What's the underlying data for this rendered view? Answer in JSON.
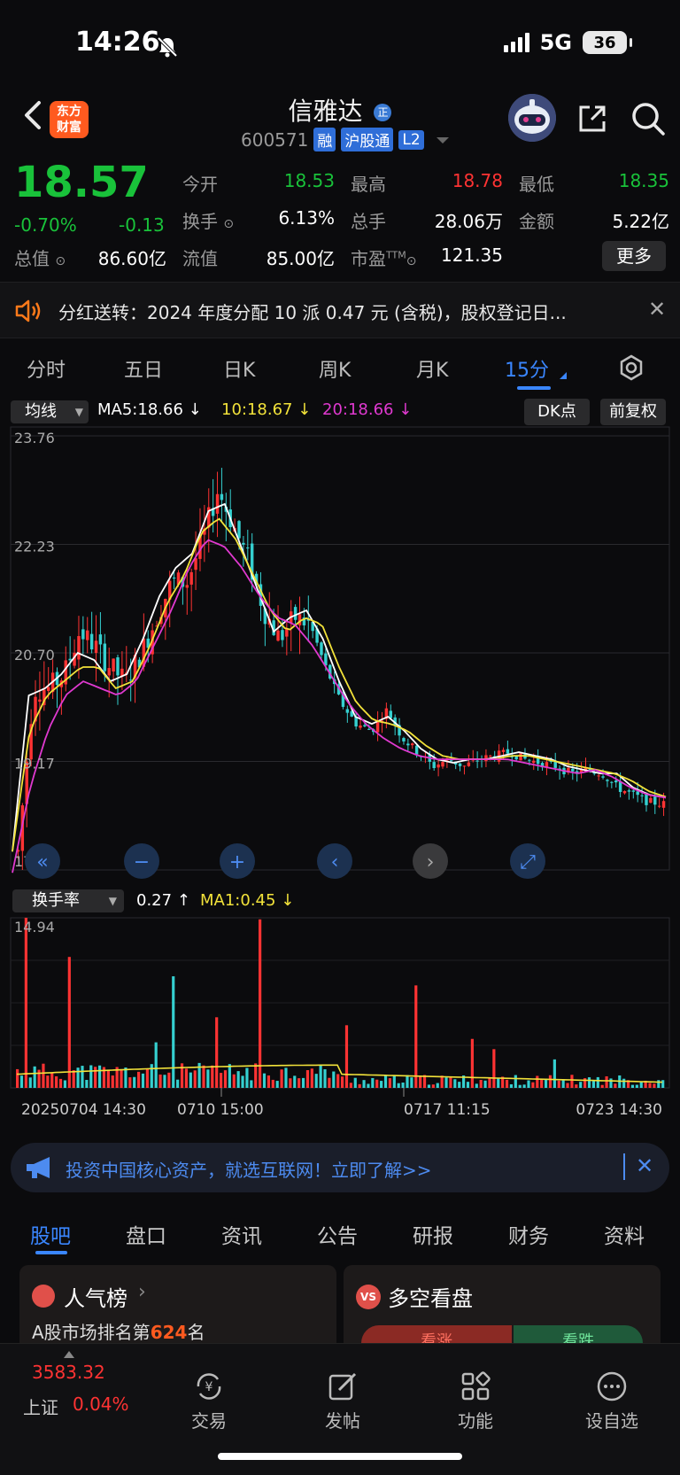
{
  "status_bar": {
    "time": "14:26",
    "network": "5G",
    "battery": "36"
  },
  "header": {
    "logo_line1": "东方",
    "logo_line2": "财富",
    "stock_name": "信雅达",
    "name_badge": "正",
    "stock_code": "600571",
    "tags": [
      "融",
      "沪股通",
      "L2"
    ]
  },
  "quote": {
    "price": "18.57",
    "change_pct": "-0.70%",
    "change": "-0.13",
    "open_label": "今开",
    "open": "18.53",
    "high_label": "最高",
    "high": "18.78",
    "low_label": "最低",
    "low": "18.35",
    "turnover_label": "换手",
    "turnover": "6.13%",
    "volume_label": "总手",
    "volume": "28.06万",
    "amount_label": "金额",
    "amount": "5.22亿",
    "total_cap_label": "总值",
    "total_cap": "86.60亿",
    "float_cap_label": "流值",
    "float_cap": "85.00亿",
    "pe_label": "市盈",
    "pe_sup": "TTM",
    "pe": "121.35",
    "more": "更多"
  },
  "notice": {
    "text": "分红送转：2024 年度分配 10 派 0.47 元 (含税)，股权登记日..."
  },
  "period_tabs": [
    "分时",
    "五日",
    "日K",
    "周K",
    "月K",
    "15分"
  ],
  "indicators": {
    "ma_select": "均线",
    "ma5": "MA5:18.66",
    "ma10": "10:18.67",
    "ma20": "20:18.66",
    "dk": "DK点",
    "adjust": "前复权",
    "turn_select": "换手率",
    "turn_value": "0.27",
    "turn_ma": "MA1:0.45"
  },
  "chart_data": {
    "type": "candlestick",
    "price_axis": [
      "23.76",
      "22.23",
      "20.70",
      "19.17",
      "17.64"
    ],
    "ylim": [
      17.64,
      23.76
    ],
    "volume_axis_max": "14.94",
    "x_labels": [
      "20250704 14:30",
      "0710 15:00",
      "0717 11:15",
      "0723 14:30"
    ],
    "colors": {
      "up": "#ff3333",
      "down": "#35d0d0",
      "ma5": "#ffffff",
      "ma10": "#f2e23a",
      "ma20": "#e039d0"
    },
    "close_path": [
      17.9,
      20.2,
      20.2,
      20.4,
      21.0,
      20.8,
      20.5,
      20.3,
      20.7,
      21.2,
      21.7,
      21.7,
      22.3,
      23.0,
      22.5,
      22.0,
      21.3,
      20.9,
      21.2,
      21.1,
      20.5,
      20.0,
      19.7,
      19.6,
      19.9,
      19.5,
      19.3,
      19.1,
      19.2,
      19.1,
      19.2,
      19.25,
      19.3,
      19.2,
      19.15,
      19.1,
      19.0,
      19.05,
      19.0,
      18.8,
      18.7,
      18.6,
      18.57
    ],
    "ma5_path": [
      17.9,
      20.1,
      20.2,
      20.4,
      20.7,
      20.6,
      20.3,
      20.4,
      20.9,
      21.5,
      21.9,
      22.1,
      22.7,
      22.8,
      22.2,
      21.6,
      21.0,
      21.2,
      21.3,
      20.9,
      20.3,
      19.8,
      19.7,
      19.8,
      19.6,
      19.35,
      19.2,
      19.15,
      19.2,
      19.2,
      19.25,
      19.3,
      19.25,
      19.2,
      19.1,
      19.05,
      19.0,
      19.0,
      18.8,
      18.7,
      18.66
    ],
    "ma10_path": [
      17.9,
      19.6,
      20.1,
      20.3,
      20.5,
      20.5,
      20.2,
      20.3,
      20.8,
      21.4,
      21.8,
      22.4,
      22.6,
      22.3,
      21.8,
      21.3,
      21.0,
      21.2,
      21.1,
      20.5,
      20.0,
      19.75,
      19.7,
      19.6,
      19.4,
      19.25,
      19.2,
      19.2,
      19.2,
      19.25,
      19.25,
      19.2,
      19.15,
      19.1,
      19.05,
      19.0,
      18.9,
      18.75,
      18.67
    ],
    "ma20_path": [
      17.6,
      18.8,
      19.6,
      20.1,
      20.3,
      20.2,
      20.1,
      20.3,
      20.8,
      21.3,
      21.9,
      22.3,
      22.2,
      21.9,
      21.5,
      21.2,
      21.1,
      20.8,
      20.4,
      20.0,
      19.7,
      19.5,
      19.35,
      19.25,
      19.2,
      19.2,
      19.2,
      19.2,
      19.2,
      19.15,
      19.1,
      19.05,
      19.0,
      19.05,
      18.95,
      18.8,
      18.7,
      18.66
    ],
    "turnover_spikes": [
      14.94,
      11.5,
      4.0,
      9.8,
      6.2,
      14.8,
      5.5,
      9.0,
      4.3,
      3.4,
      2.5,
      2.8,
      1.6,
      1.2,
      1.0,
      0.9,
      0.8,
      0.7,
      0.6,
      0.5,
      0.45,
      0.27
    ]
  },
  "ad": {
    "text": "投资中国核心资产，就选互联网！立即了解>>"
  },
  "bottom_tabs": [
    "股吧",
    "盘口",
    "资讯",
    "公告",
    "研报",
    "财务",
    "资料"
  ],
  "cards": {
    "left_title": "人气榜",
    "left_sub_prefix": "A股市场排名第",
    "left_rank": "624",
    "left_sub_suffix": "名",
    "right_badge": "VS",
    "right_title": "多空看盘",
    "right_up": "看涨",
    "right_down": "看跌"
  },
  "bottom_nav": {
    "index_value": "3583.32",
    "index_name": "上证",
    "index_change": "0.04%",
    "trade": "交易",
    "post": "发帖",
    "functions": "功能",
    "watchlist": "设自选"
  }
}
